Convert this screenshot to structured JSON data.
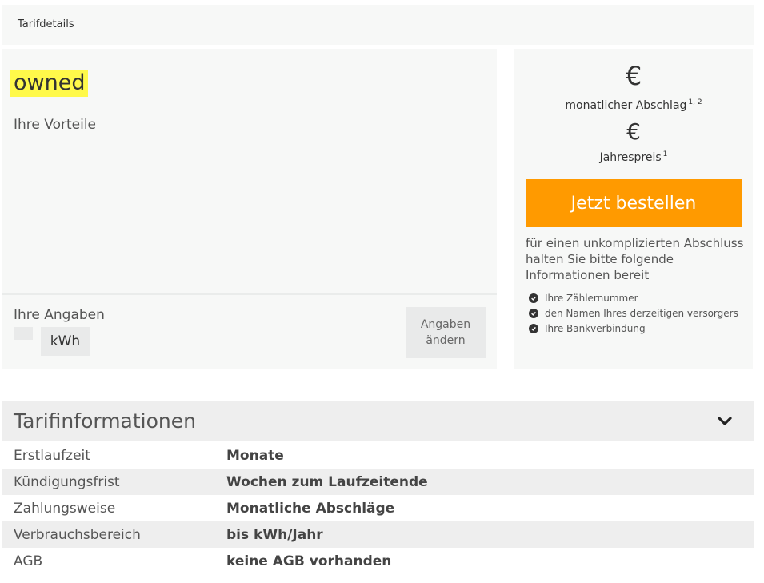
{
  "header": {
    "title": "Tarifdetails"
  },
  "tariff": {
    "name": "owned",
    "benefits_label": "Ihre Vorteile",
    "inputs_label": "Ihre Angaben",
    "unit": "kWh",
    "change_button": [
      "Angaben",
      "ändern"
    ]
  },
  "pricing": {
    "monthly_currency": "€",
    "monthly_label": "monatlicher Abschlag",
    "monthly_sup": "1, 2",
    "yearly_currency": "€",
    "yearly_label": "Jahrespreis",
    "yearly_sup": "1",
    "order_button": "Jetzt bestellen",
    "info_text": "für einen unkomplizierten Abschluss halten Sie bitte folgende Informationen bereit",
    "checklist": [
      "Ihre Zählernummer",
      "den Namen Ihres derzeitigen versorgers",
      "Ihre Bankverbindung"
    ]
  },
  "tarifinfo": {
    "title": "Tarifinformationen",
    "rows": [
      {
        "key": "Erstlaufzeit",
        "value": "Monate"
      },
      {
        "key": "Kündigungsfrist",
        "value": "Wochen zum Laufzeitende"
      },
      {
        "key": "Zahlungsweise",
        "value": "Monatliche Abschläge"
      },
      {
        "key": "Verbrauchsbereich",
        "value": "bis kWh/Jahr"
      },
      {
        "key": "AGB",
        "value": "keine AGB vorhanden"
      }
    ]
  },
  "colors": {
    "accent_orange": "#ff9a00",
    "highlight_yellow": "#fff94a",
    "panel_bg": "#f7f8f7",
    "row_alt_bg": "#eeeeee"
  }
}
